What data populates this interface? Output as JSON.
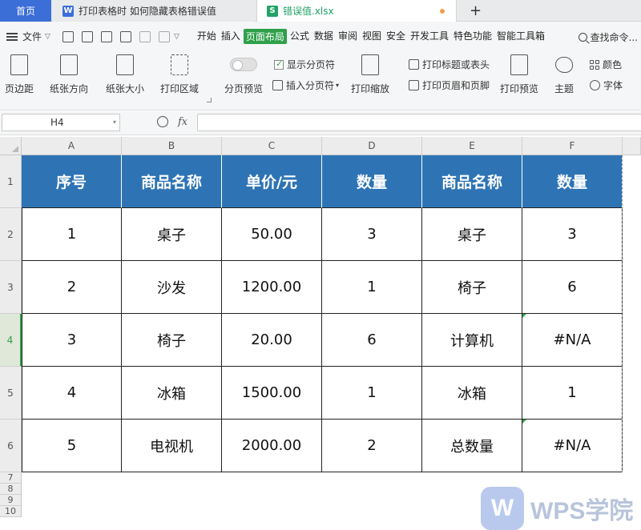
{
  "tabs": {
    "home": "首页",
    "doc1": "打印表格时 如何隐藏表格错误值",
    "doc2": "错误值.xlsx"
  },
  "menubar": {
    "file": "文件",
    "items": [
      "开始",
      "插入",
      "页面布局",
      "公式",
      "数据",
      "审阅",
      "视图",
      "安全",
      "开发工具",
      "特色功能",
      "智能工具箱"
    ],
    "active_index": 2,
    "search": "查找命令..."
  },
  "ribbon": {
    "margins": "页边距",
    "orientation": "纸张方向",
    "size": "纸张大小",
    "print_area": "打印区域",
    "page_break_preview": "分页预览",
    "show_page_break": "显示分页符",
    "insert_page_break": "插入分页符",
    "print_scale": "打印缩放",
    "print_titles": "打印标题或表头",
    "header_footer": "打印页眉和页脚",
    "print_preview": "打印预览",
    "theme": "主题",
    "color": "颜色",
    "font": "字体"
  },
  "formula_bar": {
    "cell_ref": "H4",
    "fx": "fx",
    "value": ""
  },
  "sheet": {
    "columns": [
      "A",
      "B",
      "C",
      "D",
      "E",
      "F"
    ],
    "row_numbers": [
      "1",
      "2",
      "3",
      "4",
      "5",
      "6",
      "7",
      "8",
      "9",
      "10"
    ],
    "selected_row": 4,
    "header": [
      "序号",
      "商品名称",
      "单价/元",
      "数量",
      "商品名称",
      "数量"
    ],
    "rows": [
      [
        "1",
        "桌子",
        "50.00",
        "3",
        "桌子",
        "3"
      ],
      [
        "2",
        "沙发",
        "1200.00",
        "1",
        "椅子",
        "6"
      ],
      [
        "3",
        "椅子",
        "20.00",
        "6",
        "计算机",
        "#N/A"
      ],
      [
        "4",
        "冰箱",
        "1500.00",
        "1",
        "冰箱",
        "1"
      ],
      [
        "5",
        "电视机",
        "2000.00",
        "2",
        "总数量",
        "#N/A"
      ]
    ]
  },
  "watermark": "WPS学院",
  "colors": {
    "header_fill": "#2e74b5",
    "home_tab": "#3c6ed8",
    "active_menu": "#2ea04a"
  }
}
